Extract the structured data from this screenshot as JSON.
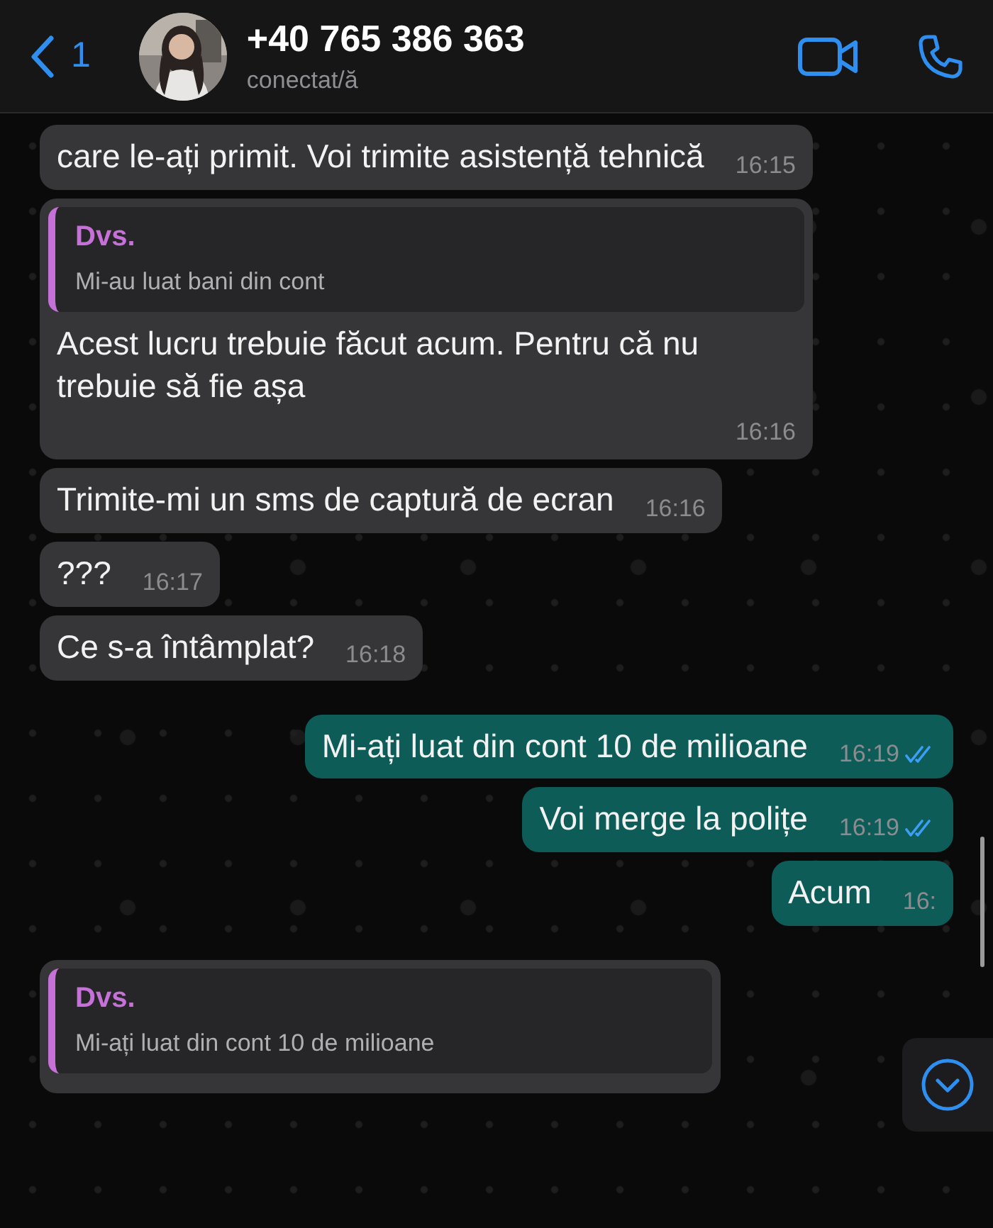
{
  "header": {
    "back_count": "1",
    "contact_name": "+40 765 386 363",
    "status": "conectat/ă"
  },
  "messages": [
    {
      "kind": "incoming",
      "text": "care le-ați primit. Voi trimite asistență tehnică",
      "time": "16:15"
    },
    {
      "kind": "incoming",
      "quote": {
        "author": "Dvs.",
        "text": "Mi-au luat bani din cont"
      },
      "text": "Acest lucru trebuie făcut acum. Pentru că nu trebuie să fie așa",
      "time": "16:16"
    },
    {
      "kind": "incoming",
      "text": "Trimite-mi un sms de captură de ecran",
      "time": "16:16"
    },
    {
      "kind": "incoming",
      "text": "???",
      "time": "16:17"
    },
    {
      "kind": "incoming",
      "text": "Ce s-a întâmplat?",
      "time": "16:18"
    },
    {
      "kind": "outgoing",
      "text": "Mi-ați luat din cont 10 de milioane",
      "time": "16:19",
      "read": true
    },
    {
      "kind": "outgoing",
      "text": "Voi merge la polițe",
      "time": "16:19",
      "read": true
    },
    {
      "kind": "outgoing",
      "text": "Acum",
      "time": "16:"
    },
    {
      "kind": "incoming",
      "quote": {
        "author": "Dvs.",
        "text": "Mi-ați luat din cont 10 de milioane"
      }
    }
  ]
}
